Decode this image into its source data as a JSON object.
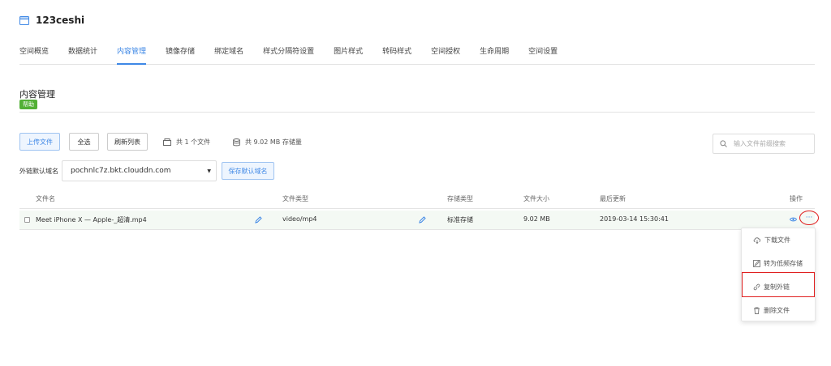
{
  "header": {
    "title": "123ceshi",
    "icon": "bucket-icon"
  },
  "tabs": [
    {
      "label": "空间概览"
    },
    {
      "label": "数据统计"
    },
    {
      "label": "内容管理",
      "active": true
    },
    {
      "label": "镜像存储"
    },
    {
      "label": "绑定域名"
    },
    {
      "label": "样式分隔符设置"
    },
    {
      "label": "图片样式"
    },
    {
      "label": "转码样式"
    },
    {
      "label": "空间授权"
    },
    {
      "label": "生命周期"
    },
    {
      "label": "空间设置"
    }
  ],
  "section": {
    "title": "内容管理",
    "help_badge": "帮助"
  },
  "toolbar": {
    "upload_label": "上传文件",
    "select_all_label": "全选",
    "refresh_label": "刷新列表",
    "file_count": "共 1 个文件",
    "storage_used": "共 9.02 MB 存储量"
  },
  "search": {
    "placeholder": "输入文件前缀搜索"
  },
  "domain": {
    "label": "外链默认域名",
    "selected": "pochnlc7z.bkt.clouddn.com",
    "save_label": "保存默认域名"
  },
  "table": {
    "headers": {
      "name": "文件名",
      "type": "文件类型",
      "storage": "存储类型",
      "size": "文件大小",
      "updated": "最后更新",
      "actions": "操作"
    },
    "rows": [
      {
        "name": "Meet iPhone X — Apple-_超清.mp4",
        "type": "video/mp4",
        "storage": "标准存储",
        "size": "9.02 MB",
        "updated": "2019-03-14 15:30:41",
        "more": "···"
      }
    ]
  },
  "dropdown": {
    "items": [
      {
        "label": "下载文件",
        "icon": "cloud-download-icon"
      },
      {
        "label": "转为低频存储",
        "icon": "convert-icon"
      },
      {
        "label": "复制外链",
        "icon": "link-icon"
      },
      {
        "label": "删除文件",
        "icon": "trash-icon"
      }
    ]
  },
  "colors": {
    "accent": "#3f88e6",
    "help_green": "#52b035",
    "highlight_red": "#e02020",
    "row_bg": "#f4f9f4"
  }
}
